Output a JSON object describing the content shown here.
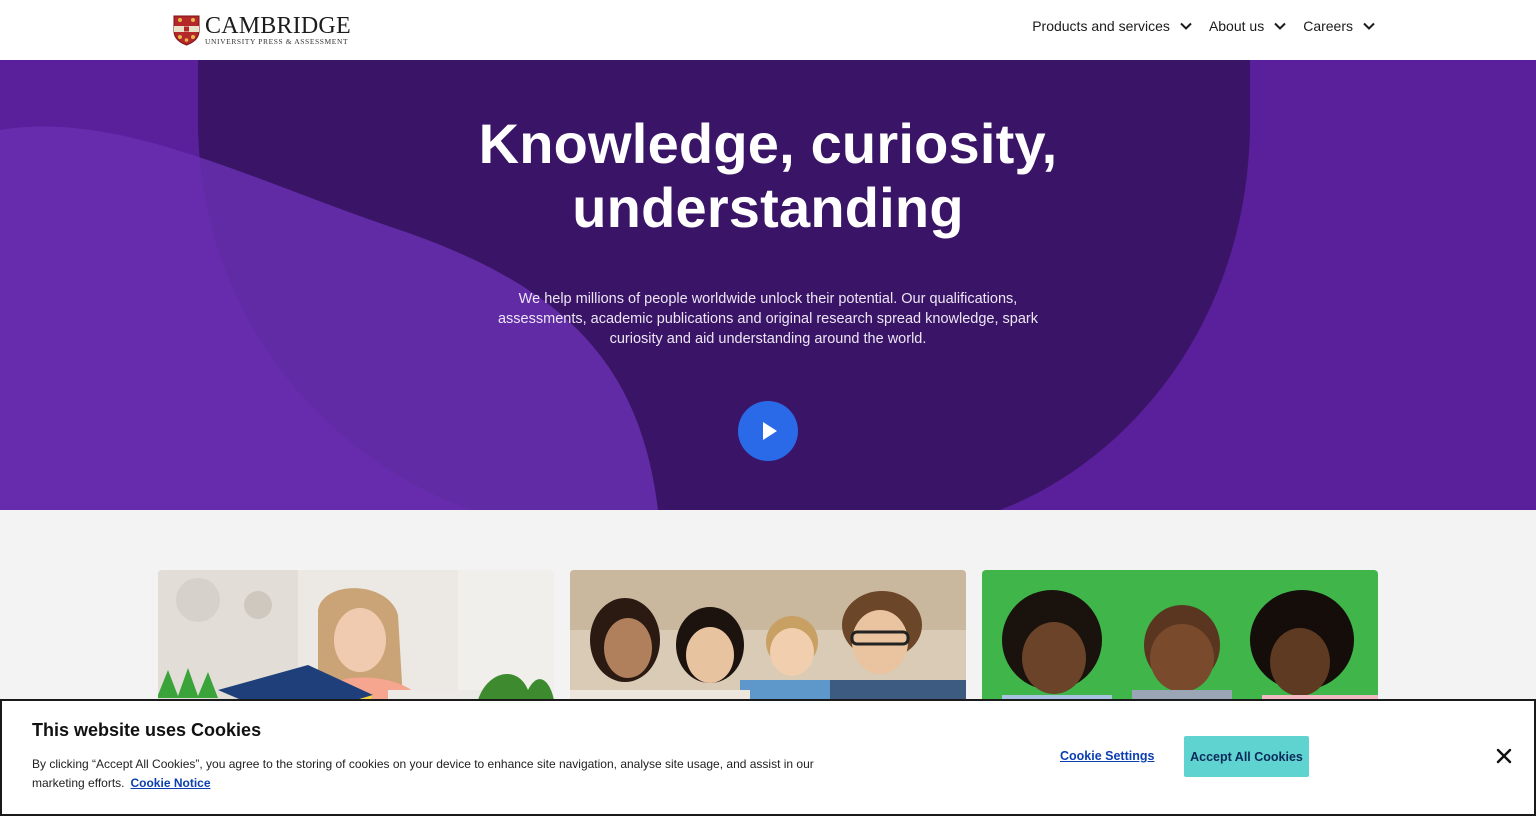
{
  "header": {
    "logo_main": "CAMBRIDGE",
    "logo_sub": "UNIVERSITY PRESS & ASSESSMENT",
    "nav": [
      {
        "label": "Products and services"
      },
      {
        "label": "About us"
      },
      {
        "label": "Careers"
      }
    ]
  },
  "hero": {
    "title_line1": "Knowledge, curiosity,",
    "title_line2": "understanding",
    "subtitle": "We help millions of people worldwide unlock their potential. Our qualifications, assessments, academic publications and original research spread knowledge, spark curiosity and aid understanding around the world.",
    "play_icon": "play-icon"
  },
  "cards": [
    {
      "image": "woman-reading-book-photo"
    },
    {
      "image": "students-group-smiling-photo"
    },
    {
      "image": "children-reading-green-photo"
    }
  ],
  "cookie": {
    "title": "This website uses Cookies",
    "text": "By clicking “Accept All Cookies”, you agree to the storing of cookies on your device to enhance site navigation, analyse site usage, and assist in our marketing efforts.",
    "notice_link": "Cookie Notice",
    "settings_label": "Cookie Settings",
    "accept_label": "Accept All Cookies"
  },
  "colors": {
    "hero_purple": "#5a1f9a",
    "hero_dark": "#3a1466",
    "play_blue": "#2a6ae8",
    "accept_teal": "#5fd3d0",
    "link_blue": "#0b3fb0"
  }
}
